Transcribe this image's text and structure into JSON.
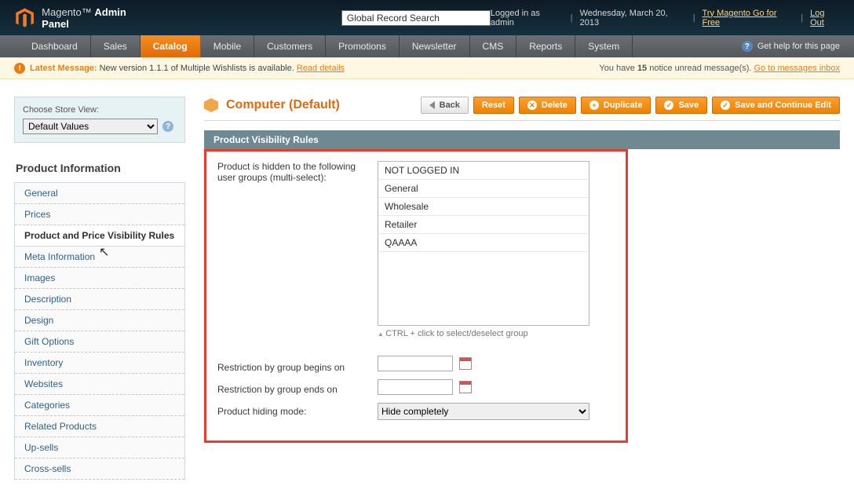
{
  "header": {
    "brand_prefix": "Magento",
    "brand_suffix": "Admin Panel",
    "search_value": "Global Record Search",
    "logged_in": "Logged in as admin",
    "date": "Wednesday, March 20, 2013",
    "try_link": "Try Magento Go for Free",
    "logout": "Log Out"
  },
  "nav": {
    "items": [
      "Dashboard",
      "Sales",
      "Catalog",
      "Mobile",
      "Customers",
      "Promotions",
      "Newsletter",
      "CMS",
      "Reports",
      "System"
    ],
    "active_index": 2,
    "help": "Get help for this page"
  },
  "messagebar": {
    "latest_label": "Latest Message:",
    "text": "New version 1.1.1 of Multiple Wishlists is available.",
    "read_link": "Read details",
    "right_prefix": "You have ",
    "right_count": "15",
    "right_suffix": " notice unread message(s). ",
    "go_link": "Go to messages inbox"
  },
  "sidebar": {
    "store_view_label": "Choose Store View:",
    "store_view_value": "Default Values",
    "panel_title": "Product Information",
    "tabs": [
      "General",
      "Prices",
      "Product and Price Visibility Rules",
      "Meta Information",
      "Images",
      "Description",
      "Design",
      "Gift Options",
      "Inventory",
      "Websites",
      "Categories",
      "Related Products",
      "Up-sells",
      "Cross-sells"
    ],
    "active_tab_index": 2
  },
  "content": {
    "title": "Computer (Default)",
    "buttons": {
      "back": "Back",
      "reset": "Reset",
      "delete": "Delete",
      "duplicate": "Duplicate",
      "save": "Save",
      "save_continue": "Save and Continue Edit"
    },
    "section_title": "Product Visibility Rules",
    "form": {
      "groups_label": "Product is hidden to the following user groups (multi-select):",
      "groups": [
        "NOT LOGGED IN",
        "General",
        "Wholesale",
        "Retailer",
        "QAAAA"
      ],
      "hint": "CTRL + click to select/deselect group",
      "begin_label": "Restriction by group begins on",
      "end_label": "Restriction by group ends on",
      "mode_label": "Product hiding mode:",
      "mode_value": "Hide completely"
    }
  }
}
